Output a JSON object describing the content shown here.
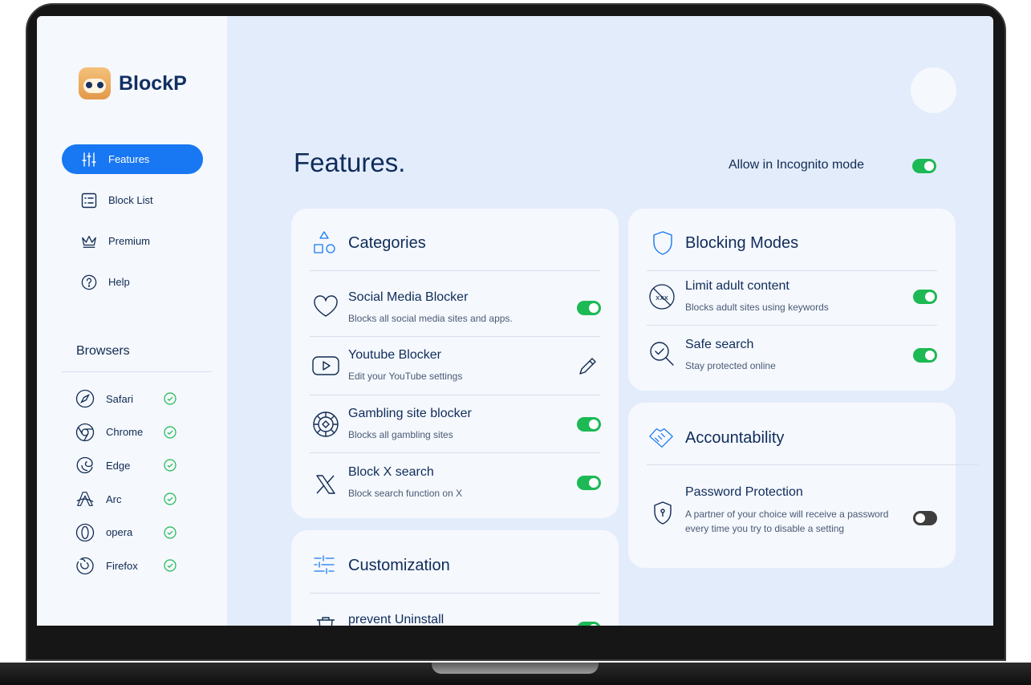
{
  "app": {
    "name": "BlockP"
  },
  "sidebar": {
    "nav": [
      {
        "label": "Features",
        "icon": "sliders-icon",
        "active": true
      },
      {
        "label": "Block List",
        "icon": "list-icon",
        "active": false
      },
      {
        "label": "Premium",
        "icon": "crown-icon",
        "active": false
      },
      {
        "label": "Help",
        "icon": "help-icon",
        "active": false
      }
    ],
    "browsers_title": "Browsers",
    "browsers": [
      {
        "name": "Safari",
        "icon": "safari-icon",
        "status": "check-icon"
      },
      {
        "name": "Chrome",
        "icon": "chrome-icon",
        "status": "check-icon"
      },
      {
        "name": "Edge",
        "icon": "edge-icon",
        "status": "check-icon"
      },
      {
        "name": "Arc",
        "icon": "arc-icon",
        "status": "check-icon"
      },
      {
        "name": "opera",
        "icon": "opera-icon",
        "status": "check-icon"
      },
      {
        "name": "Firefox",
        "icon": "firefox-icon",
        "status": "check-icon"
      }
    ]
  },
  "main": {
    "title": "Features.",
    "incognito": {
      "label": "Allow in Incognito mode",
      "enabled": true
    },
    "categories": {
      "title": "Categories",
      "items": [
        {
          "title": "Social Media Blocker",
          "desc": "Blocks all social media sites and apps.",
          "icon": "heart-icon",
          "control": "toggle",
          "enabled": true
        },
        {
          "title": "Youtube Blocker",
          "desc": "Edit your YouTube settings",
          "icon": "youtube-icon",
          "control": "edit",
          "enabled": null
        },
        {
          "title": "Gambling site blocker",
          "desc": "Blocks all gambling sites",
          "icon": "poker-chip-icon",
          "control": "toggle",
          "enabled": true
        },
        {
          "title": "Block X search",
          "desc": "Block search function on X",
          "icon": "x-logo-icon",
          "control": "toggle",
          "enabled": true
        }
      ]
    },
    "customization": {
      "title": "Customization",
      "items": [
        {
          "title": "prevent Uninstall",
          "icon": "trash-icon",
          "control": "toggle",
          "enabled": true
        }
      ]
    },
    "blocking_modes": {
      "title": "Blocking Modes",
      "items": [
        {
          "title": "Limit adult content",
          "desc": "Blocks adult sites using keywords",
          "icon": "xxx-block-icon",
          "control": "toggle",
          "enabled": true
        },
        {
          "title": "Safe search",
          "desc": "Stay protected online",
          "icon": "safe-search-icon",
          "control": "toggle",
          "enabled": true
        }
      ]
    },
    "accountability": {
      "title": "Accountability",
      "items": [
        {
          "title": "Password Protection",
          "desc": "A partner of your choice will receive a password every time you try to disable a setting",
          "icon": "shield-lock-icon",
          "control": "toggle",
          "enabled": false
        }
      ]
    }
  },
  "colors": {
    "accent": "#1877f2",
    "toggle_on": "#1db954",
    "toggle_off": "#3e3e3e",
    "text_primary": "#0f2c5a",
    "background": "#e3ecfb",
    "card": "#f5f8fd"
  }
}
